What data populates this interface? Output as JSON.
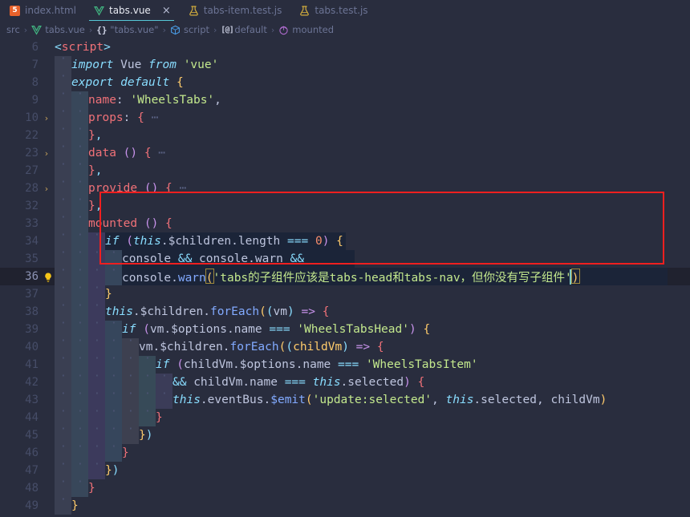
{
  "tabs": [
    {
      "label": "index.html",
      "icon": "html5-icon",
      "active": false,
      "closable": false
    },
    {
      "label": "tabs.vue",
      "icon": "vue-icon",
      "active": true,
      "closable": true,
      "close_label": "×"
    },
    {
      "label": "tabs-item.test.js",
      "icon": "test-flask-icon",
      "active": false,
      "closable": false
    },
    {
      "label": "tabs.test.js",
      "icon": "test-flask-icon",
      "active": false,
      "closable": false
    }
  ],
  "breadcrumb": {
    "separator": "›",
    "items": [
      {
        "label": "src",
        "icon": "none"
      },
      {
        "label": "tabs.vue",
        "icon": "vue-icon"
      },
      {
        "label": "\"tabs.vue\"",
        "icon": "braces-icon"
      },
      {
        "label": "script",
        "icon": "cube-icon"
      },
      {
        "label": "default",
        "icon": "at-symbol-icon"
      },
      {
        "label": "mounted",
        "icon": "method-icon"
      }
    ]
  },
  "colors": {
    "background": "#292d3e",
    "current_line": "#20222f",
    "accent_tab_underline": "#56c8d8",
    "annotation_border": "#f01f1f",
    "string": "#c3e88d",
    "keyword": "#89ddff",
    "property": "#f07178",
    "function": "#82aaff",
    "variable": "#bec5de",
    "line_number": "#464d68"
  },
  "editor": {
    "language": "vue",
    "lines": [
      {
        "num": "6",
        "fold": "",
        "indent": 0,
        "current": false,
        "bulb": false,
        "tokens": [
          {
            "t": "<",
            "c": "t-punct"
          },
          {
            "t": "script",
            "c": "t-tag"
          },
          {
            "t": ">",
            "c": "t-punct"
          }
        ]
      },
      {
        "num": "7",
        "fold": "",
        "indent": 1,
        "current": false,
        "bulb": false,
        "tokens": [
          {
            "t": "import",
            "c": "t-kw"
          },
          {
            "t": " Vue ",
            "c": "t-var"
          },
          {
            "t": "from",
            "c": "t-kw"
          },
          {
            "t": " ",
            "c": "t-plain"
          },
          {
            "t": "'vue'",
            "c": "t-str"
          }
        ]
      },
      {
        "num": "8",
        "fold": "",
        "indent": 1,
        "current": false,
        "bulb": false,
        "tokens": [
          {
            "t": "export",
            "c": "t-kw"
          },
          {
            "t": " ",
            "c": "t-plain"
          },
          {
            "t": "default",
            "c": "t-kw"
          },
          {
            "t": " ",
            "c": "t-plain"
          },
          {
            "t": "{",
            "c": "t-brace-y"
          }
        ]
      },
      {
        "num": "9",
        "fold": "",
        "indent": 2,
        "current": false,
        "bulb": false,
        "tokens": [
          {
            "t": "name",
            "c": "t-prop"
          },
          {
            "t": ": ",
            "c": "t-plain"
          },
          {
            "t": "'WheelsTabs'",
            "c": "t-str"
          },
          {
            "t": ",",
            "c": "t-plain"
          }
        ]
      },
      {
        "num": "10",
        "fold": "›",
        "indent": 2,
        "current": false,
        "bulb": false,
        "tokens": [
          {
            "t": "props",
            "c": "t-prop"
          },
          {
            "t": ": ",
            "c": "t-plain"
          },
          {
            "t": "{",
            "c": "t-brace-pk"
          },
          {
            "t": " ⋯",
            "c": "t-dots"
          }
        ]
      },
      {
        "num": "22",
        "fold": "",
        "indent": 2,
        "current": false,
        "bulb": false,
        "tokens": [
          {
            "t": "}",
            "c": "t-brace-pk"
          },
          {
            "t": ",",
            "c": "t-punct"
          }
        ]
      },
      {
        "num": "23",
        "fold": "›",
        "indent": 2,
        "current": false,
        "bulb": false,
        "tokens": [
          {
            "t": "data",
            "c": "t-prop"
          },
          {
            "t": " () ",
            "c": "t-brace-p"
          },
          {
            "t": "{",
            "c": "t-brace-pk"
          },
          {
            "t": " ⋯",
            "c": "t-dots"
          }
        ]
      },
      {
        "num": "27",
        "fold": "",
        "indent": 2,
        "current": false,
        "bulb": false,
        "tokens": [
          {
            "t": "}",
            "c": "t-brace-pk"
          },
          {
            "t": ",",
            "c": "t-punct"
          }
        ]
      },
      {
        "num": "28",
        "fold": "›",
        "indent": 2,
        "current": false,
        "bulb": false,
        "tokens": [
          {
            "t": "provide",
            "c": "t-prop"
          },
          {
            "t": " () ",
            "c": "t-brace-p"
          },
          {
            "t": "{",
            "c": "t-brace-pk"
          },
          {
            "t": " ⋯",
            "c": "t-dots"
          }
        ]
      },
      {
        "num": "32",
        "fold": "",
        "indent": 2,
        "current": false,
        "bulb": false,
        "tokens": [
          {
            "t": "}",
            "c": "t-brace-pk"
          },
          {
            "t": ",",
            "c": "t-punct"
          }
        ]
      },
      {
        "num": "33",
        "fold": "",
        "indent": 2,
        "current": false,
        "bulb": false,
        "tokens": [
          {
            "t": "mounted",
            "c": "t-prop"
          },
          {
            "t": " () ",
            "c": "t-brace-p"
          },
          {
            "t": "{",
            "c": "t-brace-pk"
          }
        ]
      },
      {
        "num": "34",
        "fold": "",
        "indent": 3,
        "current": false,
        "bulb": false,
        "tokens": [
          {
            "t": "if",
            "c": "t-kw"
          },
          {
            "t": " (",
            "c": "t-brace-p"
          },
          {
            "t": "this",
            "c": "t-this"
          },
          {
            "t": ".",
            "c": "t-plain"
          },
          {
            "t": "$children",
            "c": "t-var"
          },
          {
            "t": ".",
            "c": "t-plain"
          },
          {
            "t": "length",
            "c": "t-var"
          },
          {
            "t": " === ",
            "c": "t-op"
          },
          {
            "t": "0",
            "c": "t-num"
          },
          {
            "t": ")",
            "c": "t-brace-p"
          },
          {
            "t": " ",
            "c": "t-plain"
          },
          {
            "t": "{",
            "c": "t-brace-y"
          }
        ]
      },
      {
        "num": "35",
        "fold": "",
        "indent": 4,
        "current": false,
        "bulb": false,
        "tokens": [
          {
            "t": "console",
            "c": "t-var"
          },
          {
            "t": " && ",
            "c": "t-op"
          },
          {
            "t": "console",
            "c": "t-var"
          },
          {
            "t": ".",
            "c": "t-plain"
          },
          {
            "t": "warn",
            "c": "t-var"
          },
          {
            "t": " &&",
            "c": "t-op"
          }
        ]
      },
      {
        "num": "36",
        "fold": "",
        "indent": 4,
        "current": true,
        "bulb": true,
        "tokens": [
          {
            "t": "console",
            "c": "t-var"
          },
          {
            "t": ".",
            "c": "t-plain"
          },
          {
            "t": "warn",
            "c": "t-fn"
          },
          {
            "t": "(",
            "c": "t-brace-y"
          },
          {
            "t": "'tabs的子组件应该是tabs-head和tabs-nav，但你没有写子组件'",
            "c": "t-cn"
          },
          {
            "t": ")",
            "c": "t-brace-y"
          }
        ]
      },
      {
        "num": "37",
        "fold": "",
        "indent": 3,
        "current": false,
        "bulb": false,
        "tokens": [
          {
            "t": "}",
            "c": "t-brace-y"
          }
        ]
      },
      {
        "num": "38",
        "fold": "",
        "indent": 3,
        "current": false,
        "bulb": false,
        "tokens": [
          {
            "t": "this",
            "c": "t-this"
          },
          {
            "t": ".",
            "c": "t-plain"
          },
          {
            "t": "$children",
            "c": "t-var"
          },
          {
            "t": ".",
            "c": "t-plain"
          },
          {
            "t": "forEach",
            "c": "t-fn"
          },
          {
            "t": "(",
            "c": "t-brace-y"
          },
          {
            "t": "(",
            "c": "t-brace-b"
          },
          {
            "t": "vm",
            "c": "t-var"
          },
          {
            "t": ")",
            "c": "t-brace-b"
          },
          {
            "t": " ",
            "c": "t-plain"
          },
          {
            "t": "=>",
            "c": "t-kw2"
          },
          {
            "t": " ",
            "c": "t-plain"
          },
          {
            "t": "{",
            "c": "t-brace-pk"
          }
        ]
      },
      {
        "num": "39",
        "fold": "",
        "indent": 4,
        "current": false,
        "bulb": false,
        "tokens": [
          {
            "t": "if",
            "c": "t-kw"
          },
          {
            "t": " (",
            "c": "t-brace-p"
          },
          {
            "t": "vm",
            "c": "t-var"
          },
          {
            "t": ".",
            "c": "t-plain"
          },
          {
            "t": "$options",
            "c": "t-var"
          },
          {
            "t": ".",
            "c": "t-plain"
          },
          {
            "t": "name",
            "c": "t-var"
          },
          {
            "t": " === ",
            "c": "t-op"
          },
          {
            "t": "'WheelsTabsHead'",
            "c": "t-str"
          },
          {
            "t": ")",
            "c": "t-brace-p"
          },
          {
            "t": " ",
            "c": "t-plain"
          },
          {
            "t": "{",
            "c": "t-brace-y"
          }
        ]
      },
      {
        "num": "40",
        "fold": "",
        "indent": 5,
        "current": false,
        "bulb": false,
        "tokens": [
          {
            "t": "vm",
            "c": "t-var"
          },
          {
            "t": ".",
            "c": "t-plain"
          },
          {
            "t": "$children",
            "c": "t-var"
          },
          {
            "t": ".",
            "c": "t-plain"
          },
          {
            "t": "forEach",
            "c": "t-fn"
          },
          {
            "t": "(",
            "c": "t-brace-y"
          },
          {
            "t": "(",
            "c": "t-brace-b"
          },
          {
            "t": "childVm",
            "c": "t-brace-y"
          },
          {
            "t": ")",
            "c": "t-brace-b"
          },
          {
            "t": " ",
            "c": "t-plain"
          },
          {
            "t": "=>",
            "c": "t-kw2"
          },
          {
            "t": " ",
            "c": "t-plain"
          },
          {
            "t": "{",
            "c": "t-brace-pk"
          }
        ]
      },
      {
        "num": "41",
        "fold": "",
        "indent": 6,
        "current": false,
        "bulb": false,
        "tokens": [
          {
            "t": "if",
            "c": "t-kw"
          },
          {
            "t": " (",
            "c": "t-brace-p"
          },
          {
            "t": "childVm",
            "c": "t-var"
          },
          {
            "t": ".",
            "c": "t-plain"
          },
          {
            "t": "$options",
            "c": "t-var"
          },
          {
            "t": ".",
            "c": "t-plain"
          },
          {
            "t": "name",
            "c": "t-var"
          },
          {
            "t": " === ",
            "c": "t-op"
          },
          {
            "t": "'WheelsTabsItem'",
            "c": "t-str"
          }
        ]
      },
      {
        "num": "42",
        "fold": "",
        "indent": 7,
        "current": false,
        "bulb": false,
        "tokens": [
          {
            "t": "&& ",
            "c": "t-op"
          },
          {
            "t": "childVm",
            "c": "t-var"
          },
          {
            "t": ".",
            "c": "t-plain"
          },
          {
            "t": "name",
            "c": "t-var"
          },
          {
            "t": " === ",
            "c": "t-op"
          },
          {
            "t": "this",
            "c": "t-this"
          },
          {
            "t": ".",
            "c": "t-plain"
          },
          {
            "t": "selected",
            "c": "t-var"
          },
          {
            "t": ")",
            "c": "t-brace-p"
          },
          {
            "t": " ",
            "c": "t-plain"
          },
          {
            "t": "{",
            "c": "t-brace-pk"
          }
        ]
      },
      {
        "num": "43",
        "fold": "",
        "indent": 7,
        "current": false,
        "bulb": false,
        "tokens": [
          {
            "t": "this",
            "c": "t-this"
          },
          {
            "t": ".",
            "c": "t-plain"
          },
          {
            "t": "eventBus",
            "c": "t-var"
          },
          {
            "t": ".",
            "c": "t-plain"
          },
          {
            "t": "$emit",
            "c": "t-fn"
          },
          {
            "t": "(",
            "c": "t-brace-y"
          },
          {
            "t": "'update:selected'",
            "c": "t-str"
          },
          {
            "t": ", ",
            "c": "t-plain"
          },
          {
            "t": "this",
            "c": "t-this"
          },
          {
            "t": ".",
            "c": "t-plain"
          },
          {
            "t": "selected",
            "c": "t-var"
          },
          {
            "t": ", ",
            "c": "t-plain"
          },
          {
            "t": "childVm",
            "c": "t-var"
          },
          {
            "t": ")",
            "c": "t-brace-y"
          }
        ]
      },
      {
        "num": "44",
        "fold": "",
        "indent": 6,
        "current": false,
        "bulb": false,
        "tokens": [
          {
            "t": "}",
            "c": "t-brace-pk"
          }
        ]
      },
      {
        "num": "45",
        "fold": "",
        "indent": 5,
        "current": false,
        "bulb": false,
        "tokens": [
          {
            "t": "}",
            "c": "t-brace-y"
          },
          {
            "t": ")",
            "c": "t-brace-b"
          }
        ]
      },
      {
        "num": "46",
        "fold": "",
        "indent": 4,
        "current": false,
        "bulb": false,
        "tokens": [
          {
            "t": "}",
            "c": "t-brace-pk"
          }
        ]
      },
      {
        "num": "47",
        "fold": "",
        "indent": 3,
        "current": false,
        "bulb": false,
        "tokens": [
          {
            "t": "}",
            "c": "t-brace-y"
          },
          {
            "t": ")",
            "c": "t-brace-b"
          }
        ]
      },
      {
        "num": "48",
        "fold": "",
        "indent": 2,
        "current": false,
        "bulb": false,
        "tokens": [
          {
            "t": "}",
            "c": "t-brace-pk"
          }
        ]
      },
      {
        "num": "49",
        "fold": "",
        "indent": 1,
        "current": false,
        "bulb": false,
        "tokens": [
          {
            "t": "}",
            "c": "t-brace-y"
          }
        ]
      }
    ]
  },
  "annotation": {
    "shape": "rectangle",
    "color": "#f01f1f",
    "covers_lines": "34-37"
  }
}
